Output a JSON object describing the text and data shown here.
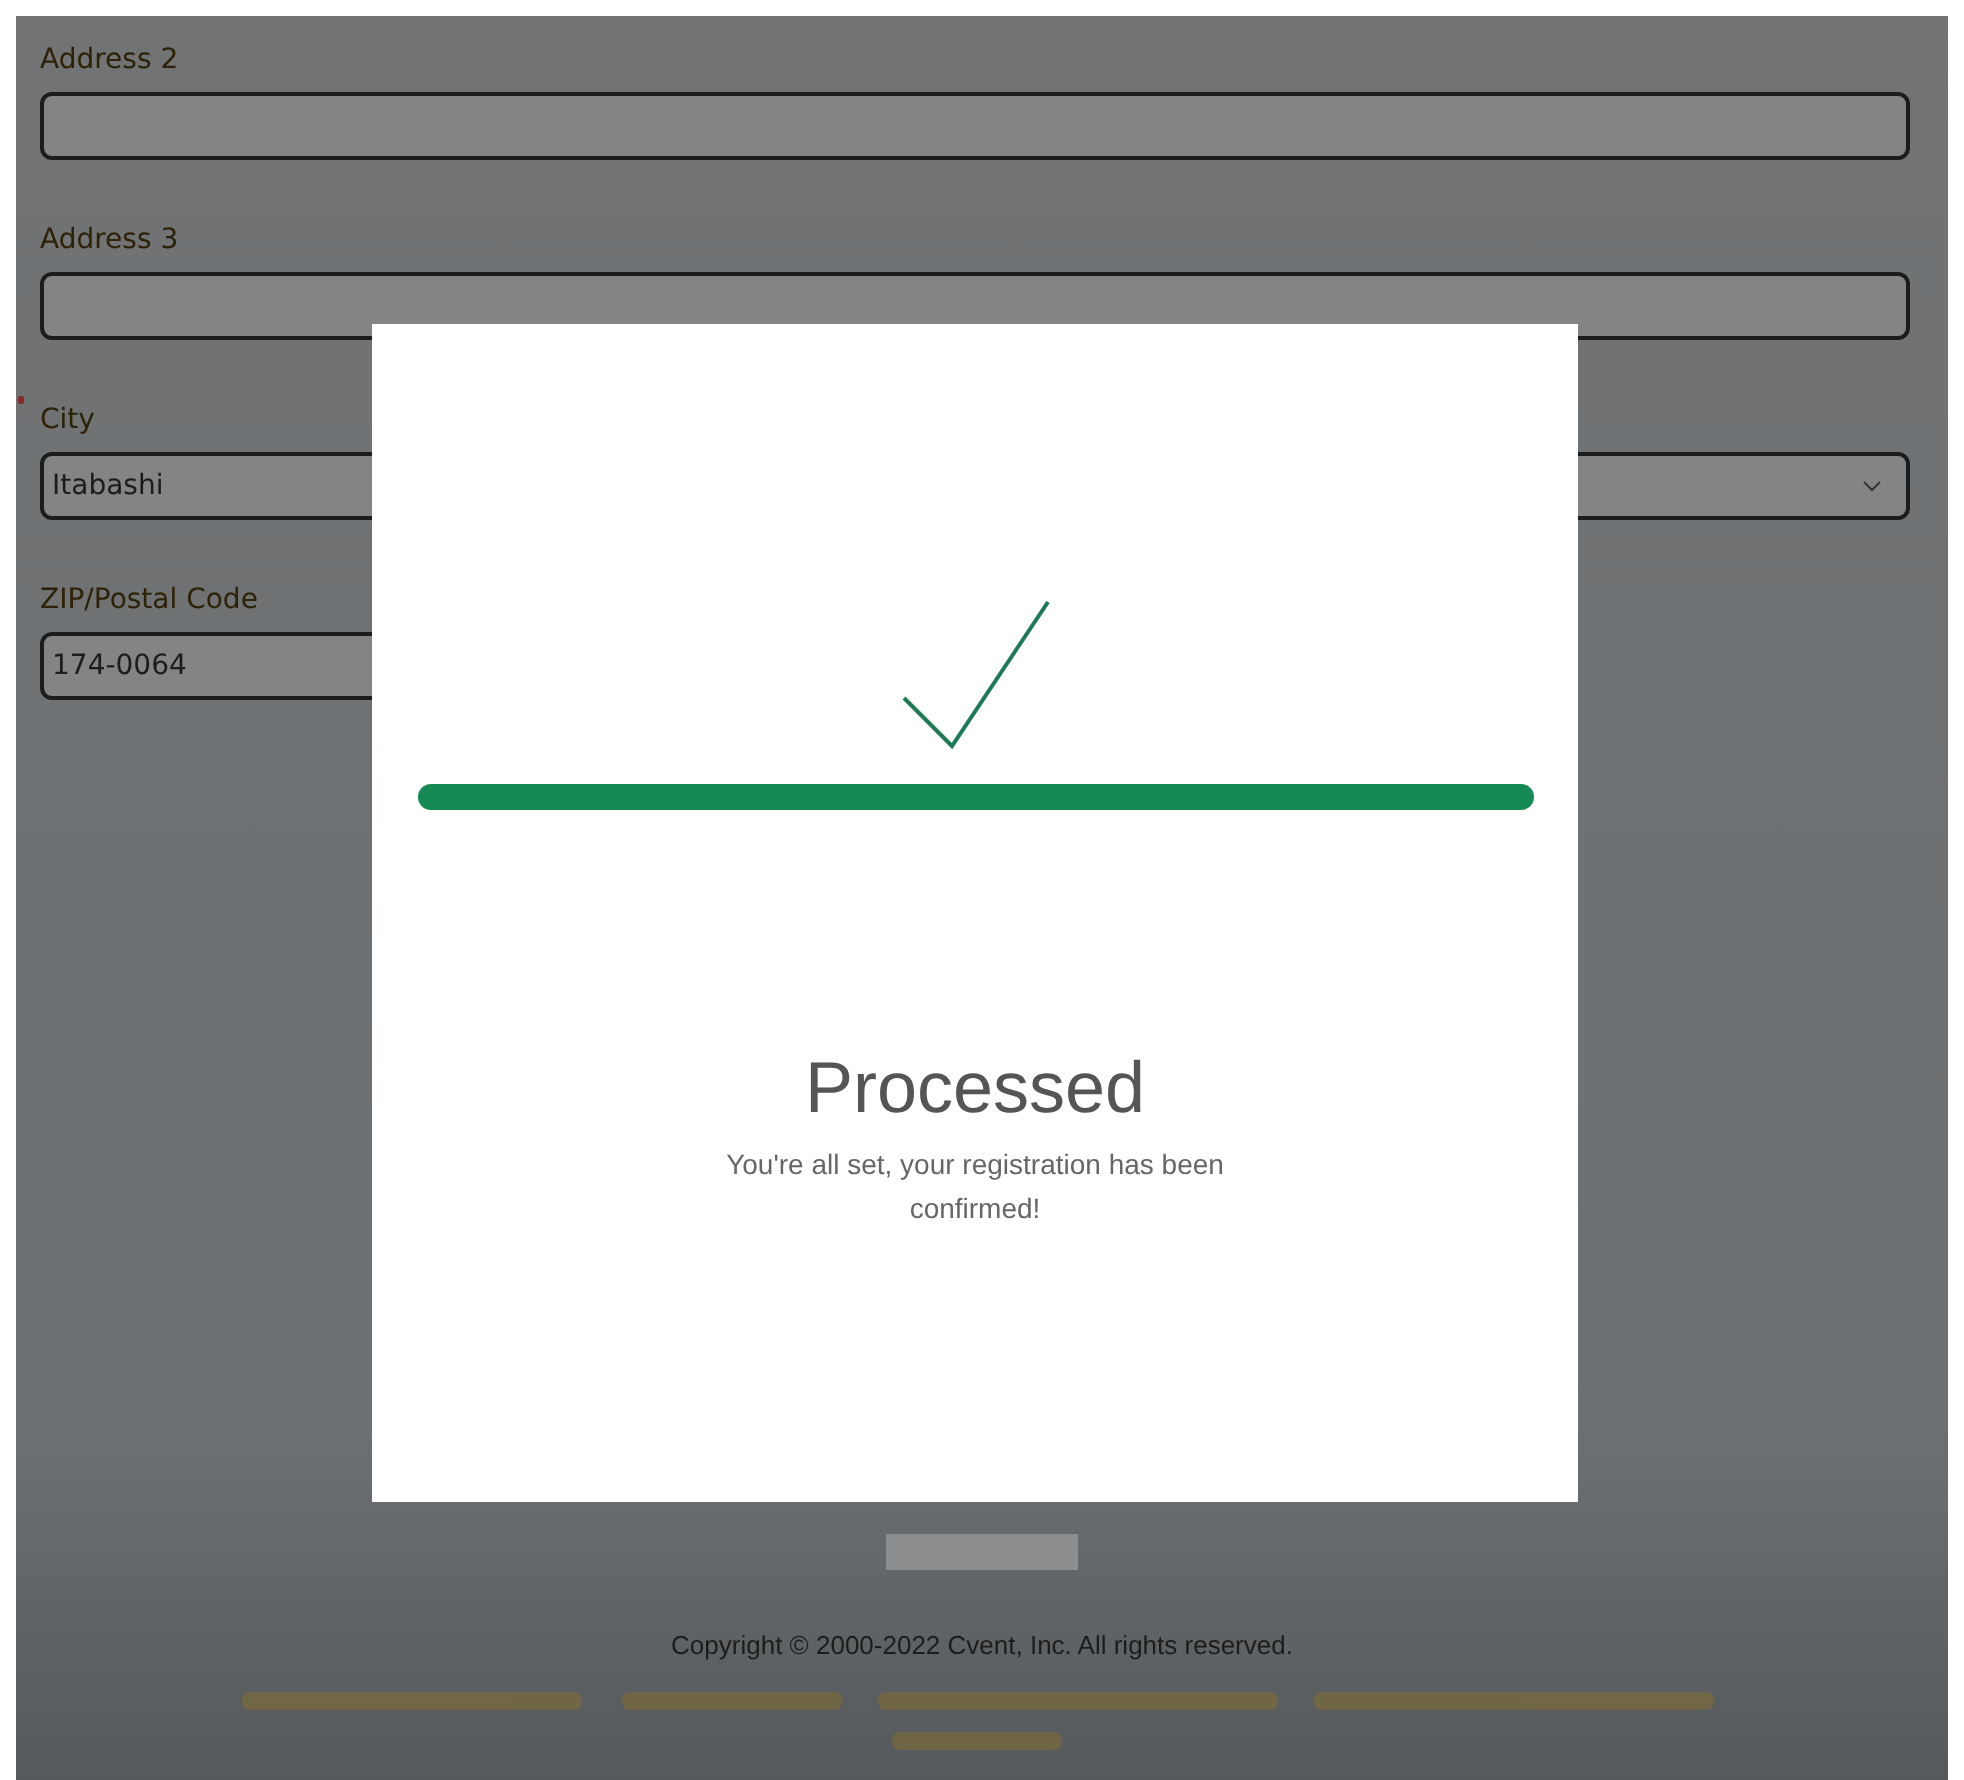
{
  "form": {
    "fields": [
      {
        "label": "Address 2",
        "kind": "text",
        "required": false
      },
      {
        "label": "Address 3",
        "kind": "text",
        "required": false
      },
      {
        "label": "City",
        "value": "Itabashi",
        "kind": "select",
        "required": true
      },
      {
        "label": "ZIP/Postal Code",
        "value": "174-0064",
        "kind": "text",
        "required": false
      }
    ]
  },
  "dialog": {
    "progress": {
      "level": 1
    },
    "title": "Processed",
    "message": "You're all set, your registration has been confirmed!"
  },
  "footer": {
    "copyright": "Copyright © 2000-2022 Cvent, Inc. All rights reserved."
  }
}
